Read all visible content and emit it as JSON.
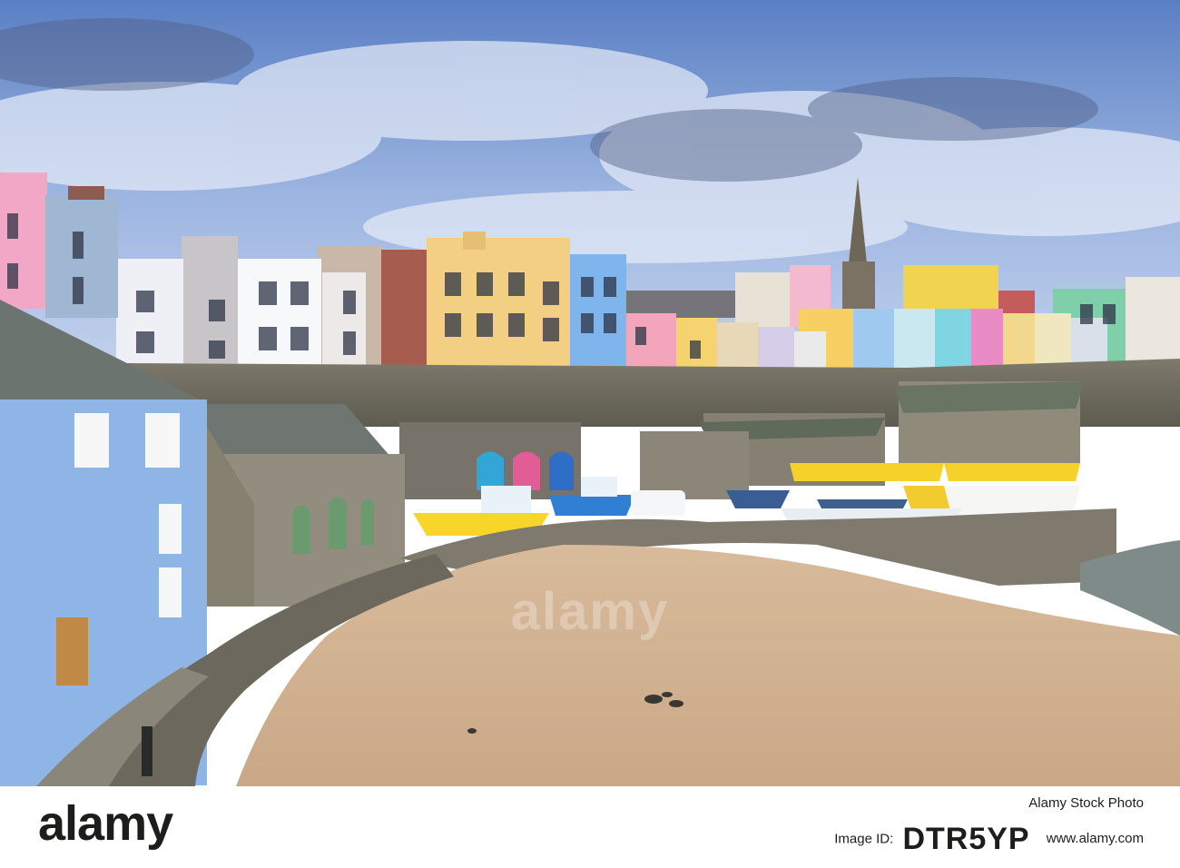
{
  "image": {
    "watermark_text": "alamy",
    "description_alt": "Harbour town with colourful houses, beach and boats"
  },
  "footer": {
    "brand": "alamy",
    "stock_line": "Alamy Stock Photo",
    "image_id_label": "Image ID:",
    "image_id": "DTR5YP",
    "url": "www.alamy.com"
  },
  "colors": {
    "sky": "#7f9fd6",
    "sand": "#d2b394",
    "wall": "#8a8576",
    "blue_house": "#8fb4e6"
  }
}
